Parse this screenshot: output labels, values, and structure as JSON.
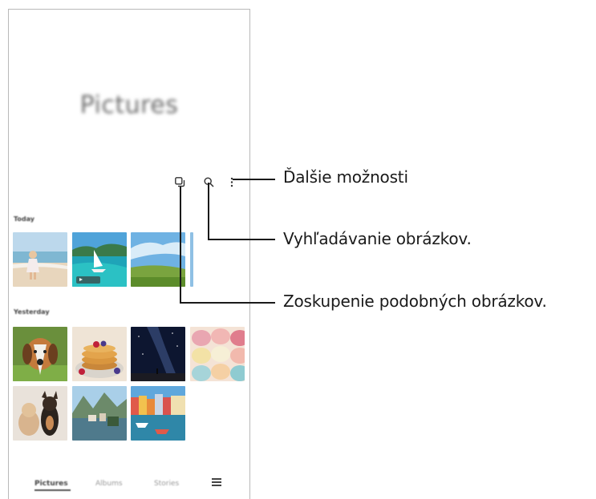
{
  "screen": {
    "title": "Pictures",
    "sections": [
      {
        "label": "Today"
      },
      {
        "label": "Yesterday"
      }
    ],
    "bottom_nav": {
      "items": [
        "Pictures",
        "Albums",
        "Stories"
      ],
      "active": "Pictures",
      "menu_icon": "hamburger-icon"
    },
    "toolbar_icons": [
      "group-similar-icon",
      "search-icon",
      "more-options-icon"
    ]
  },
  "callouts": {
    "more_options": "Ďalšie možnosti",
    "search": "Vyhľadávanie obrázkov.",
    "group_similar": "Zoskupenie podobných obrázkov."
  },
  "colors": {
    "callout_line": "#1a1a1a",
    "frame_border": "#b9b9b9"
  }
}
